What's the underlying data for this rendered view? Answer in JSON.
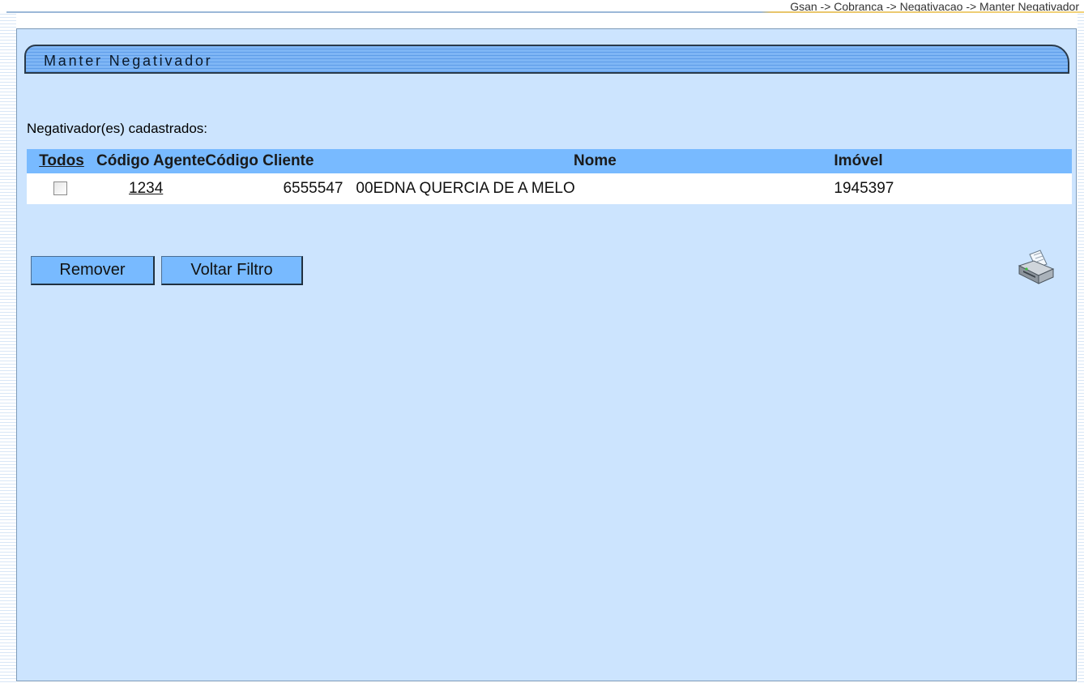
{
  "breadcrumb": "Gsan -> Cobranca -> Negativacao -> Manter Negativador",
  "page_title": "Manter Negativador",
  "list_label": "Negativador(es) cadastrados:",
  "table": {
    "headers": {
      "todos": "Todos",
      "codigo_agente": "Código Agente",
      "codigo_cliente": "Código Cliente",
      "nome": "Nome",
      "imovel": "Imóvel"
    },
    "rows": [
      {
        "checked": false,
        "codigo_agente": "1234",
        "codigo_cliente": "6555547",
        "nome": "00EDNA QUERCIA DE A MELO",
        "imovel": "1945397"
      }
    ]
  },
  "buttons": {
    "remover": "Remover",
    "voltar_filtro": "Voltar Filtro"
  },
  "icons": {
    "print": "printer-icon"
  },
  "colors": {
    "panel_bg": "#cce4fe",
    "header_bg": "#78baff",
    "button_bg": "#78baff",
    "title_tab": "#5e9de9"
  }
}
